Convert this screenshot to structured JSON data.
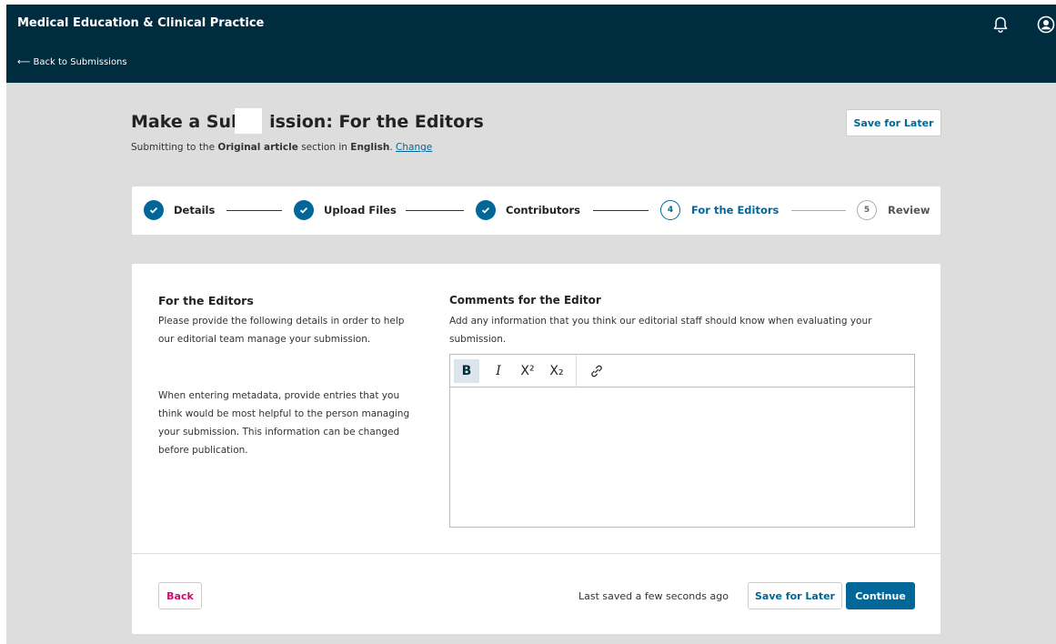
{
  "header": {
    "journal_title": "Medical Education & Clinical Practice",
    "back_link": "⟵ Back to Submissions",
    "icons": [
      "bell-icon",
      "user-icon"
    ]
  },
  "page": {
    "title": "Make a Sub   ission: For the Editors",
    "subtitle_prefix": "Submitting to the ",
    "subtitle_section": "Original article",
    "subtitle_mid": " section in ",
    "subtitle_language": "English",
    "subtitle_dot": ". ",
    "change_link": "Change",
    "save_for_later": "Save for Later"
  },
  "steps": [
    {
      "number": "1",
      "label": "Details",
      "state": "done"
    },
    {
      "number": "2",
      "label": "Upload Files",
      "state": "done"
    },
    {
      "number": "3",
      "label": "Contributors",
      "state": "done"
    },
    {
      "number": "4",
      "label": "For the Editors",
      "state": "active"
    },
    {
      "number": "5",
      "label": "Review",
      "state": "pending"
    }
  ],
  "section": {
    "title": "For the Editors",
    "description": "Please provide the following details in order to help our editorial team manage your submission.",
    "description2": "When entering metadata, provide entries that you think would be most helpful to the person managing your submission. This information can be changed before publication."
  },
  "comments": {
    "label": "Comments for the Editor",
    "description": "Add any information that you think our editorial staff should know when evaluating your submission.",
    "value": "",
    "toolbar": {
      "bold": "B",
      "italic": "I",
      "superscript": "X²",
      "subscript": "X₂"
    }
  },
  "footer": {
    "back": "Back",
    "last_saved": "Last saved a few seconds ago",
    "save_for_later": "Save for Later",
    "continue": "Continue"
  },
  "colors": {
    "header_bg": "#002c40",
    "primary": "#006798",
    "back_button": "#d00a6c"
  }
}
